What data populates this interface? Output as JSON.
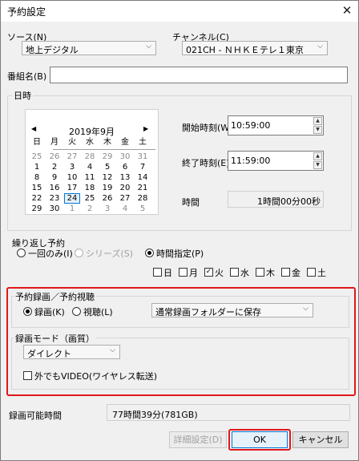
{
  "window": {
    "title": "予約設定",
    "close_glyph": "✕"
  },
  "source": {
    "label": "ソース(N)",
    "value": "地上デジタル"
  },
  "channel": {
    "label": "チャンネル(C)",
    "value": "021CH - ＮＨＫＥテレ１東京"
  },
  "program": {
    "label": "番組名(B)",
    "value": ""
  },
  "datetime": {
    "group_label": "日時",
    "calendar": {
      "prev": "◀",
      "next": "▶",
      "month": "2019年9月",
      "weekdays": [
        "日",
        "月",
        "火",
        "水",
        "木",
        "金",
        "土"
      ],
      "weeks": [
        [
          "25",
          "26",
          "27",
          "28",
          "29",
          "30",
          "31"
        ],
        [
          "1",
          "2",
          "3",
          "4",
          "5",
          "6",
          "7"
        ],
        [
          "8",
          "9",
          "10",
          "11",
          "12",
          "13",
          "14"
        ],
        [
          "15",
          "16",
          "17",
          "18",
          "19",
          "20",
          "21"
        ],
        [
          "22",
          "23",
          "24",
          "25",
          "26",
          "27",
          "28"
        ],
        [
          "29",
          "30",
          "1",
          "2",
          "3",
          "4",
          "5"
        ]
      ],
      "selected": "24"
    },
    "start": {
      "label": "開始時刻(W)",
      "value": "10:59:00"
    },
    "end": {
      "label": "終了時刻(E)",
      "value": "11:59:00"
    },
    "duration": {
      "label": "時間",
      "value": "1時間00分00秒"
    }
  },
  "repeat": {
    "label": "繰り返し予約",
    "once": "一回のみ(I)",
    "series": "シリーズ(S)",
    "time_spec": "時間指定(P)",
    "days": [
      {
        "label": "日",
        "checked": false
      },
      {
        "label": "月",
        "checked": false
      },
      {
        "label": "火",
        "checked": true
      },
      {
        "label": "水",
        "checked": false
      },
      {
        "label": "木",
        "checked": false
      },
      {
        "label": "金",
        "checked": false
      },
      {
        "label": "土",
        "checked": false
      }
    ]
  },
  "reserve": {
    "label": "予約録画／予約視聴",
    "record": "録画(K)",
    "view": "視聴(L)",
    "folder": "通常録画フォルダーに保存"
  },
  "mode": {
    "label": "録画モード（画質）",
    "value": "ダイレクト",
    "outside": "外でもVIDEO(ワイヤレス転送)"
  },
  "recordable": {
    "label": "録画可能時間",
    "value": "77時間39分(781GB)"
  },
  "buttons": {
    "detail": "詳細設定(D)",
    "ok": "OK",
    "cancel": "キャンセル"
  },
  "colors": {
    "highlight": "#e0181b",
    "accent": "#0078d7"
  }
}
